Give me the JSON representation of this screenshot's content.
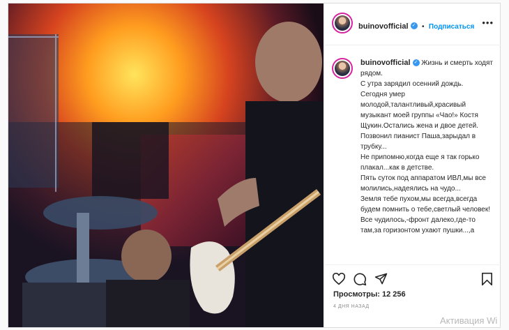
{
  "post": {
    "username": "buinovofficial",
    "follow_label": "Подписаться",
    "follow_separator": "•",
    "more_icon": "ellipsis-icon",
    "caption": "Жизнь и смерть ходят рядом.\nС утра зарядил осенний дождь.\nСегодня умер молодой,талантливый,красивый музыкант моей группы «Чао!» Костя Щукин.Остались жена и двое детей.\nПозвонил пианист Паша,зарыдал в трубку...\nНе припомню,когда еще я так горько плакал...как в детстве.\nПять суток под аппаратом ИВЛ,мы все молились,надеялись на чудо...\nЗемля тебе пухом,мы всегда,всегда будем помнить о тебе,светлый человек!\nВсе чудилось,-фронт далеко,где-то там,за горизонтом ухают пушки...,а",
    "views_label": "Просмотры: 12 256",
    "time_ago": "4 дня назад",
    "icons": [
      "heart-icon",
      "comment-icon",
      "share-icon",
      "bookmark-icon",
      "verified-badge-icon"
    ]
  },
  "watermark": "Активация Wi",
  "colors": {
    "link_blue": "#0095f6",
    "verified_blue": "#3897f0",
    "text": "#262626",
    "muted": "#8e8e8e",
    "border": "#dbdbdb"
  }
}
